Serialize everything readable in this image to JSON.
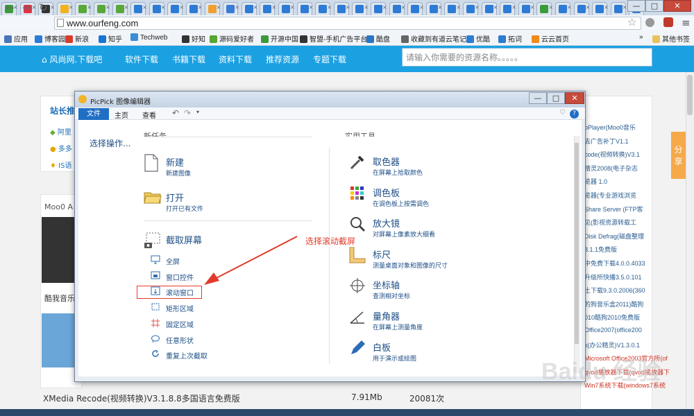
{
  "browser": {
    "url": "www.ourfeng.com",
    "controls": {
      "minimize": "—",
      "maximize": "□",
      "close": "✕"
    },
    "bookmarks": [
      {
        "label": "应用",
        "color": "#4a76b8"
      },
      {
        "label": "博客园",
        "color": "#2d7bd4"
      },
      {
        "label": "新浪",
        "color": "#d93a2b"
      },
      {
        "label": "知乎",
        "color": "#1a75d2"
      },
      {
        "label": "Techweb",
        "color": "#3a8dd6"
      },
      {
        "label": "好知",
        "color": "#333"
      },
      {
        "label": "源码爱好者",
        "color": "#57a532"
      },
      {
        "label": "开源中国",
        "color": "#3c9a3c"
      },
      {
        "label": "智盟-手机广告平台",
        "color": "#333"
      },
      {
        "label": "酷盘",
        "color": "#2a76c6"
      },
      {
        "label": "收藏到有道云笔记",
        "color": "#666"
      },
      {
        "label": "优酷",
        "color": "#2e7bd0"
      },
      {
        "label": "拓词",
        "color": "#2e7bd0"
      },
      {
        "label": "云云首页",
        "color": "#f2891d"
      }
    ],
    "bookmarks_more": "»",
    "other_bookmarks": "其他书签"
  },
  "site": {
    "nav": [
      "风尚网.下载吧",
      "软件下载",
      "书籍下载",
      "资料下载",
      "推荐资源",
      "专题下载"
    ],
    "search_placeholder": "请输入你需要的资源名称。。。。。",
    "share": "分享",
    "left_title": "站长推",
    "left_items": [
      "阿里",
      "多多",
      "IS语"
    ],
    "left_section": "Moo0 A",
    "left_caption": "酷我音乐",
    "right_list": [
      "oPlayer(Moo0音乐",
      "去广告补丁V1.1",
      "code(视频转换)V3.1",
      "精灵2008(电子杂志",
      "览器 1.0",
      "览器(专业游戏浏览",
      "Share Server (FTP客",
      "见(影视资源转载工",
      "Disk Defrag(磁盘整理",
      "8.1.1免费版",
      "中免费下载4.0.0.4033",
      "升级所快播3.5.0.101",
      "土下载9.3.0.2006(360",
      "的狗音乐盒2011)酷狗",
      "010酷狗2010免费版",
      "Office2007(office200",
      "k(办公精灵)V1.3.0.1",
      "Microsoft Office2003官方所(of",
      "qvod播放器下载(qvod播放器下",
      "Win7系统下载(windows7系统"
    ],
    "row": {
      "name": "XMedia Recode(视频转换)V3.1.8.8多国语言免费版",
      "size": "7.91Mb",
      "count": "20081次"
    }
  },
  "picpick": {
    "title": "PicPick 图像编辑器",
    "menu": [
      "文件",
      "主页",
      "查看"
    ],
    "left_label": "选择操作...",
    "section_new": "新任务",
    "section_tools": "实用工具",
    "tasks": [
      {
        "title": "新建",
        "desc": "新建图像",
        "icon": "new-file-icon"
      },
      {
        "title": "打开",
        "desc": "打开已有文件",
        "icon": "folder-open-icon"
      },
      {
        "title": "截取屏幕",
        "desc": "",
        "icon": "screen-capture-icon"
      }
    ],
    "capture_options": [
      {
        "label": "全屏",
        "icon": "monitor-icon"
      },
      {
        "label": "窗口控件",
        "icon": "window-control-icon"
      },
      {
        "label": "滚动窗口",
        "icon": "scroll-window-icon"
      },
      {
        "label": "矩形区域",
        "icon": "rectangle-icon"
      },
      {
        "label": "固定区域",
        "icon": "fixed-region-icon"
      },
      {
        "label": "任意形状",
        "icon": "lasso-icon"
      },
      {
        "label": "重复上次截取",
        "icon": "repeat-icon"
      }
    ],
    "tools": [
      {
        "title": "取色器",
        "desc": "在屏幕上拾取颜色",
        "icon": "eyedropper-icon"
      },
      {
        "title": "调色板",
        "desc": "在调色板上按需调色",
        "icon": "palette-icon"
      },
      {
        "title": "放大镜",
        "desc": "对屏幕上像素放大细看",
        "icon": "magnifier-icon"
      },
      {
        "title": "标尺",
        "desc": "测量桌面对象和图像的尺寸",
        "icon": "ruler-icon"
      },
      {
        "title": "坐标轴",
        "desc": "查测相对坐标",
        "icon": "crosshair-icon"
      },
      {
        "title": "量角器",
        "desc": "在屏幕上测量角度",
        "icon": "protractor-icon"
      },
      {
        "title": "白板",
        "desc": "用于演示或绘图",
        "icon": "pen-icon"
      }
    ]
  },
  "annotation": "选择滚动截屏",
  "watermark": "Baidu 经验"
}
